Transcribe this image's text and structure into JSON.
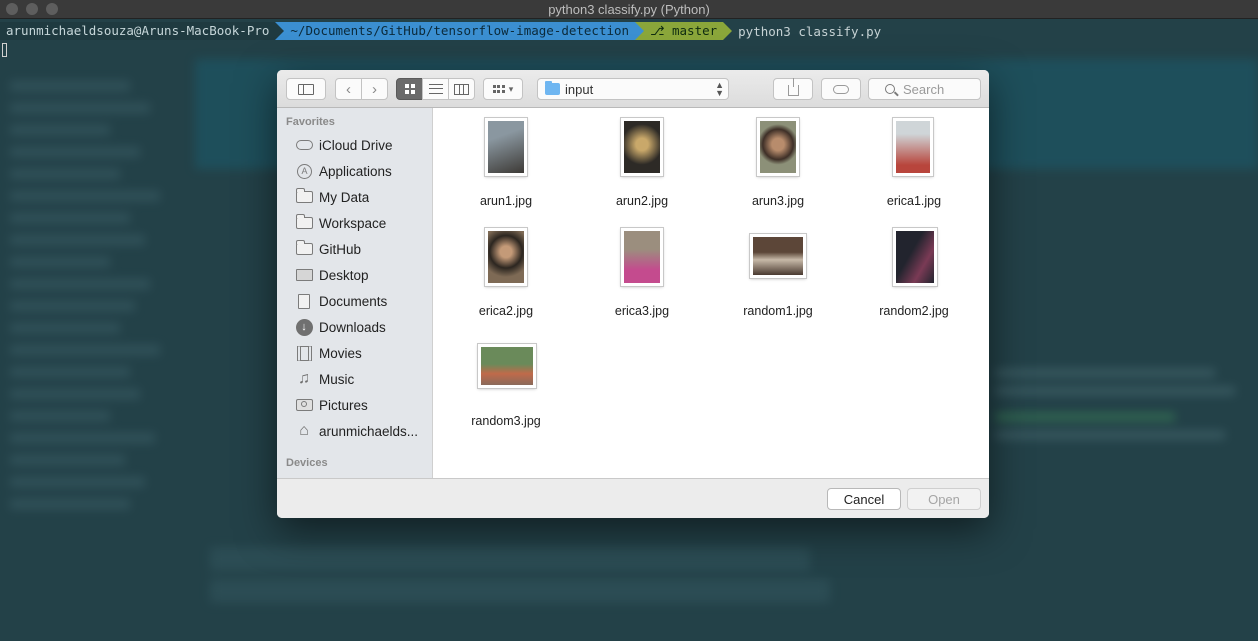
{
  "window": {
    "title": "python3 classify.py (Python)"
  },
  "terminal": {
    "user_host": "arunmichaeldsouza@Aruns-MacBook-Pro",
    "path": "~/Documents/GitHub/tensorflow-image-detection",
    "branch": "master",
    "command": "python3 classify.py"
  },
  "dialog": {
    "location": "input",
    "search_placeholder": "Search",
    "sidebar": {
      "favorites_header": "Favorites",
      "devices_header": "Devices",
      "items": [
        {
          "label": "iCloud Drive",
          "icon": "cloud-icon"
        },
        {
          "label": "Applications",
          "icon": "applications-icon"
        },
        {
          "label": "My Data",
          "icon": "folder-icon"
        },
        {
          "label": "Workspace",
          "icon": "folder-icon"
        },
        {
          "label": "GitHub",
          "icon": "folder-icon"
        },
        {
          "label": "Desktop",
          "icon": "desktop-icon"
        },
        {
          "label": "Documents",
          "icon": "documents-icon"
        },
        {
          "label": "Downloads",
          "icon": "downloads-icon"
        },
        {
          "label": "Movies",
          "icon": "movies-icon"
        },
        {
          "label": "Music",
          "icon": "music-icon"
        },
        {
          "label": "Pictures",
          "icon": "camera-icon"
        },
        {
          "label": "arunmichaelds...",
          "icon": "home-icon"
        }
      ]
    },
    "files": [
      {
        "name": "arun1.jpg",
        "colors": [
          "#8a97a0",
          "#3d3a36"
        ]
      },
      {
        "name": "arun2.jpg",
        "colors": [
          "#2d2a26",
          "#c9a86a"
        ]
      },
      {
        "name": "arun3.jpg",
        "colors": [
          "#8c9078",
          "#3e2f27"
        ]
      },
      {
        "name": "erica1.jpg",
        "colors": [
          "#cfd5d8",
          "#b8453c"
        ]
      },
      {
        "name": "erica2.jpg",
        "colors": [
          "#7e6a55",
          "#2c2620"
        ]
      },
      {
        "name": "erica3.jpg",
        "colors": [
          "#9b8e7e",
          "#c44b8e"
        ]
      },
      {
        "name": "random1.jpg",
        "colors": [
          "#5c4638",
          "#c7b9a8"
        ]
      },
      {
        "name": "random2.jpg",
        "colors": [
          "#22242e",
          "#7a3a55"
        ]
      },
      {
        "name": "random3.jpg",
        "colors": [
          "#6a8a5a",
          "#c06a4a"
        ]
      }
    ],
    "buttons": {
      "cancel": "Cancel",
      "open": "Open"
    }
  }
}
